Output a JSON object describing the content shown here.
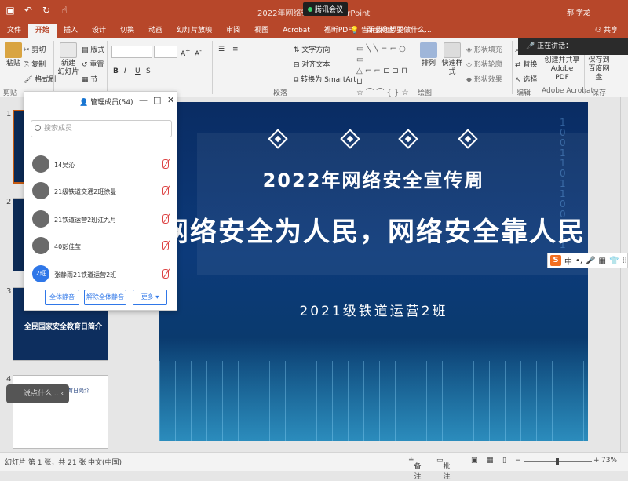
{
  "titlebar": {
    "doc_title": "2022年网络安全...",
    "app": "PowerPoint",
    "meeting": "腾讯会议",
    "user": "郝 学龙",
    "qat": [
      "save-icon",
      "undo-icon",
      "redo-icon",
      "touch-icon"
    ]
  },
  "tabs": [
    "文件",
    "开始",
    "插入",
    "设计",
    "切换",
    "动画",
    "幻灯片放映",
    "审阅",
    "视图",
    "Acrobat",
    "福昕PDF",
    "百度网盘"
  ],
  "active_tab": "开始",
  "tellme": "告诉我您想要做什么...",
  "share": "共享",
  "ribbon": {
    "paste": "粘贴",
    "cut": "剪切",
    "copy": "复制",
    "format_painter": "格式刷",
    "clipboard_group": "剪贴",
    "new_slide": "新建\n幻灯片",
    "layout": "版式",
    "reset": "重置",
    "section": "节",
    "text_direction": "文字方向",
    "align_text": "对齐文本",
    "smartart": "转换为 SmartArt",
    "paragraph_group": "段落",
    "arrange": "排列",
    "quick_styles": "快速样式",
    "shape_fill": "形状填充",
    "shape_outline": "形状轮廓",
    "shape_effects": "形状效果",
    "drawing_group": "绘图",
    "find": "查找",
    "replace": "替换",
    "select": "选择",
    "editing_group": "编辑",
    "create_pdf": "创建并共享\nAdobe PDF",
    "acrobat_group": "Adobe Acrobat",
    "save_baidu": "保存到\n百度网盘",
    "save_group": "保存",
    "speaking": "正在讲话："
  },
  "panel": {
    "title": "管理成员(54)",
    "search_placeholder": "搜索成员",
    "members": [
      {
        "name": "14吴沁",
        "avatar": ""
      },
      {
        "name": "21级铁道交通2班徐曼",
        "avatar": ""
      },
      {
        "name": "21铁道运营2班江九月",
        "avatar": ""
      },
      {
        "name": "40彭佳莹",
        "avatar": ""
      },
      {
        "name": "张静雨21铁道运营2班",
        "avatar": "2班"
      }
    ],
    "buttons": {
      "mute_all": "全体静音",
      "unmute_all": "解除全体静音",
      "more": "更多 ▾"
    }
  },
  "thumbnails": {
    "numbers": [
      "1",
      "2",
      "3",
      "4"
    ],
    "slide3_title": "全民国家安全教育日简介",
    "slide4_title": "全民国家安全教育日简介",
    "speech_placeholder": "说点什么..."
  },
  "slide": {
    "year_title": "2022年网络安全宣传周",
    "main_title": "网络安全为人民，网络安全靠人民",
    "class": "2021级铁道运营2班",
    "binary": "1001101100111"
  },
  "ime": {
    "logo": "S",
    "mode": "中"
  },
  "status": {
    "slide_info": "幻灯片 第 1 张，共 21 张",
    "language": "中文(中国)",
    "notes": "备注",
    "comments": "批注",
    "zoom": "73%"
  },
  "colors": {
    "accent": "#b7472a",
    "slide_bg": "#0a2c63",
    "member_button": "#2f77e8"
  }
}
